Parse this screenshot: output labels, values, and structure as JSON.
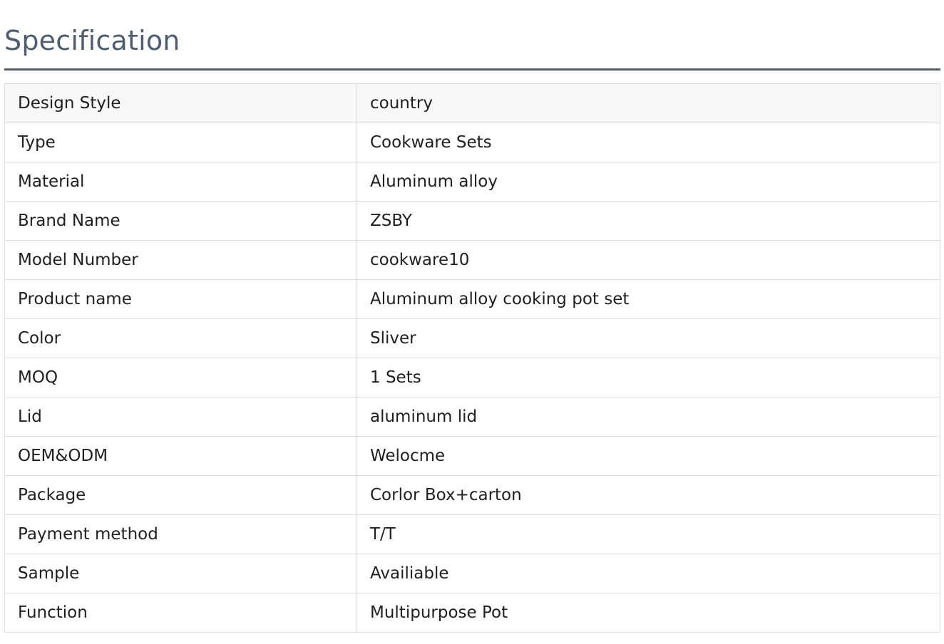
{
  "section": {
    "title": "Specification"
  },
  "spec_rows": [
    {
      "label": "Design Style",
      "value": "country"
    },
    {
      "label": "Type",
      "value": "Cookware Sets"
    },
    {
      "label": "Material",
      "value": "Aluminum alloy"
    },
    {
      "label": "Brand Name",
      "value": "ZSBY"
    },
    {
      "label": "Model Number",
      "value": "cookware10"
    },
    {
      "label": "Product name",
      "value": "Aluminum alloy cooking pot set"
    },
    {
      "label": "Color",
      "value": "Sliver"
    },
    {
      "label": "MOQ",
      "value": "1 Sets"
    },
    {
      "label": "Lid",
      "value": "aluminum lid"
    },
    {
      "label": "OEM&ODM",
      "value": "Welocme"
    },
    {
      "label": "Package",
      "value": "Corlor Box+carton"
    },
    {
      "label": "Payment method",
      "value": "T/T"
    },
    {
      "label": "Sample",
      "value": "Availiable"
    },
    {
      "label": "Function",
      "value": "Multipurpose Pot"
    }
  ],
  "colors": {
    "title": "#4f5d70",
    "rule": "#56606c",
    "border": "#dcdcdc",
    "header_row_bg": "#f6f7f8"
  }
}
